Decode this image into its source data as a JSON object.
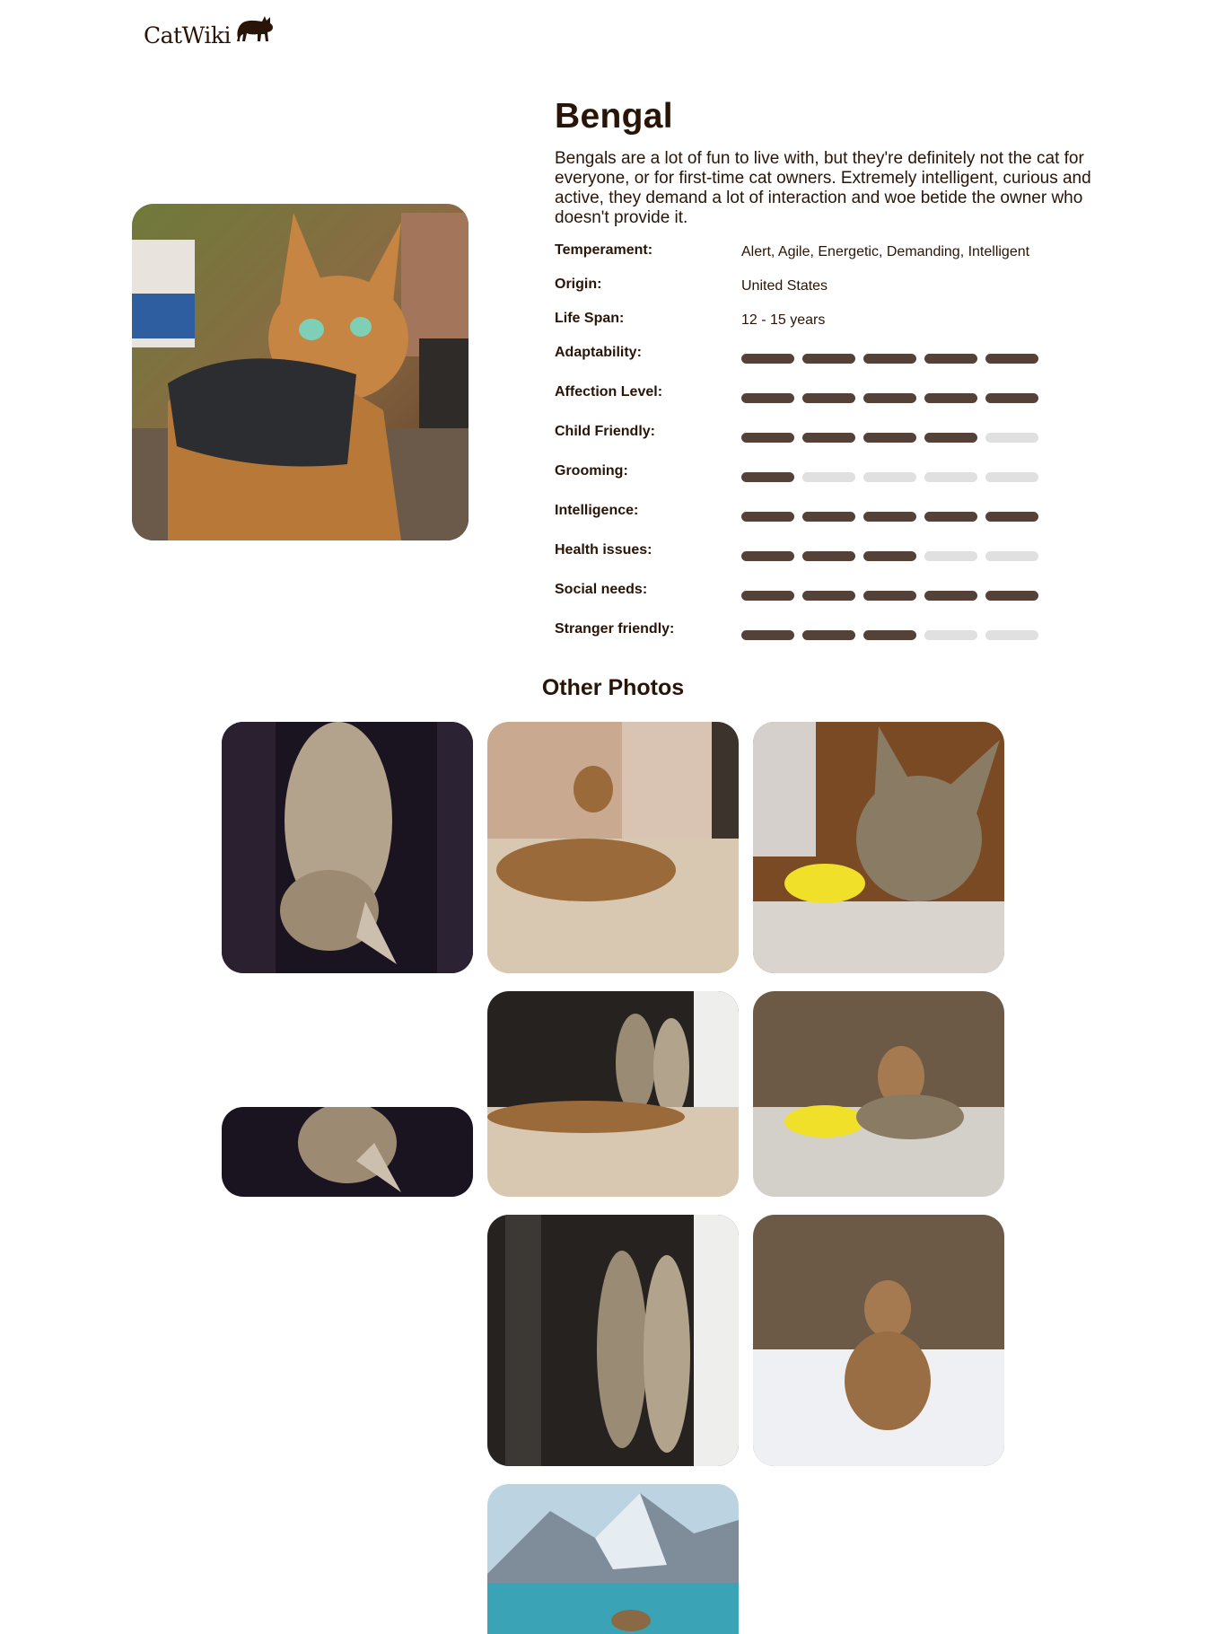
{
  "header": {
    "logo_text": "CatWiki",
    "logo_icon": "cat-silhouette-icon"
  },
  "breed": {
    "name": "Bengal",
    "description": "Bengals are a lot of fun to live with, but they're definitely not the cat for everyone, or for first-time cat owners. Extremely intelligent, curious and active, they demand a lot of interaction and woe betide the owner who doesn't provide it.",
    "temperament": {
      "label": "Temperament:",
      "value": "Alert, Agile, Energetic, Demanding, Intelligent"
    },
    "origin": {
      "label": "Origin:",
      "value": "United States"
    },
    "life_span": {
      "label": "Life Span:",
      "value": "12 - 15 years"
    },
    "ratings": [
      {
        "label": "Adaptability:",
        "level": 5,
        "max": 5
      },
      {
        "label": "Affection Level:",
        "level": 5,
        "max": 5
      },
      {
        "label": "Child Friendly:",
        "level": 4,
        "max": 5
      },
      {
        "label": "Grooming:",
        "level": 1,
        "max": 5
      },
      {
        "label": "Intelligence:",
        "level": 5,
        "max": 5
      },
      {
        "label": "Health issues:",
        "level": 3,
        "max": 5
      },
      {
        "label": "Social needs:",
        "level": 5,
        "max": 5
      },
      {
        "label": "Stranger friendly:",
        "level": 3,
        "max": 5
      }
    ]
  },
  "other_photos": {
    "title": "Other Photos",
    "count": 8
  },
  "colors": {
    "text": "#291507",
    "bar_filled": "#544238",
    "bar_empty": "#e0e0e0"
  }
}
